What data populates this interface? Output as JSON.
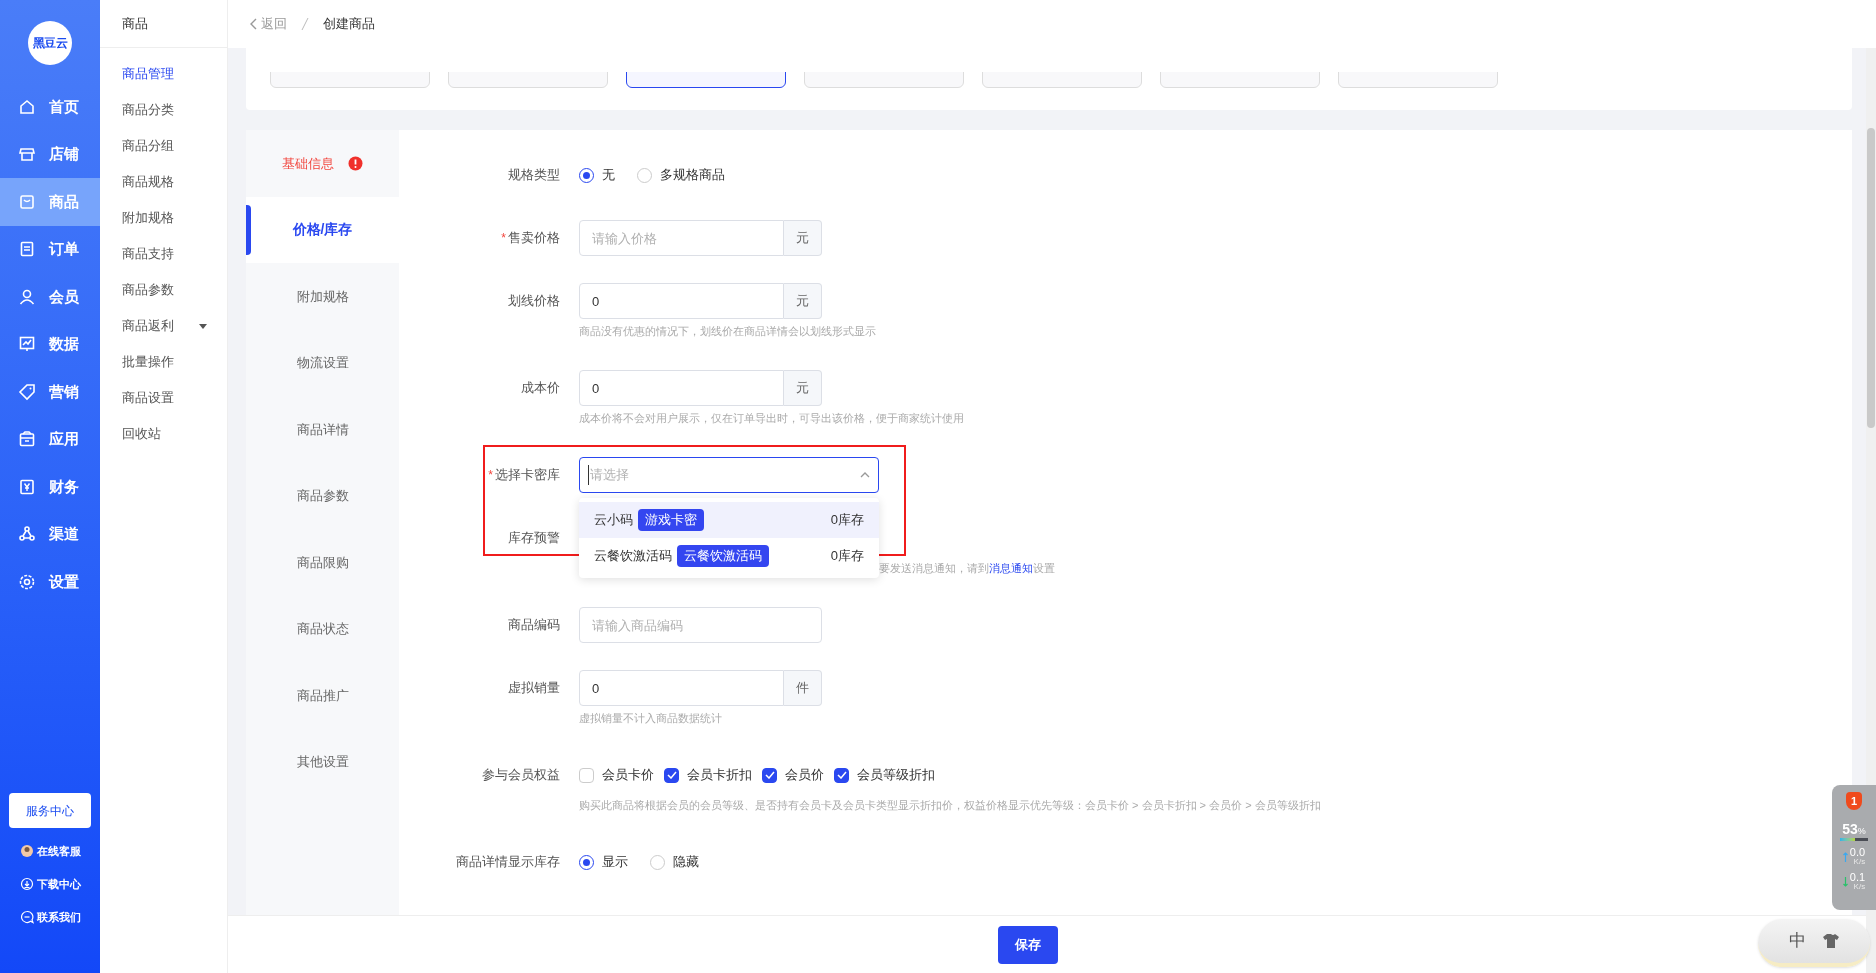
{
  "sidebar": {
    "logo": "黑豆云",
    "items": [
      {
        "label": "首页",
        "selected": false
      },
      {
        "label": "店铺",
        "selected": false
      },
      {
        "label": "商品",
        "selected": true
      },
      {
        "label": "订单",
        "selected": false
      },
      {
        "label": "会员",
        "selected": false
      },
      {
        "label": "数据",
        "selected": false
      },
      {
        "label": "营销",
        "selected": false
      },
      {
        "label": "应用",
        "selected": false
      },
      {
        "label": "财务",
        "selected": false
      },
      {
        "label": "渠道",
        "selected": false
      },
      {
        "label": "设置",
        "selected": false
      }
    ],
    "service_button": "服务中心",
    "links": [
      "在线客服",
      "下载中心",
      "联系我们"
    ]
  },
  "submenu": {
    "title": "商品",
    "items": [
      {
        "label": "商品管理",
        "selected": true,
        "kind": "link"
      },
      {
        "label": "商品分类",
        "selected": false,
        "kind": "link"
      },
      {
        "label": "商品分组",
        "selected": false,
        "kind": "link"
      },
      {
        "label": "商品规格",
        "selected": false,
        "kind": "link"
      },
      {
        "label": "附加规格",
        "selected": false,
        "kind": "link"
      },
      {
        "label": "商品支持",
        "selected": false,
        "kind": "link"
      },
      {
        "label": "商品参数",
        "selected": false,
        "kind": "link"
      },
      {
        "label": "商品返利",
        "selected": false,
        "kind": "group"
      },
      {
        "label": "批量操作",
        "selected": false,
        "kind": "link"
      },
      {
        "label": "商品设置",
        "selected": false,
        "kind": "link"
      },
      {
        "label": "回收站",
        "selected": false,
        "kind": "link"
      }
    ]
  },
  "breadcrumb": {
    "back": "返回",
    "current": "创建商品"
  },
  "type_tabs": [
    {
      "selected": false
    },
    {
      "selected": false
    },
    {
      "selected": true
    },
    {
      "selected": false
    },
    {
      "selected": false
    },
    {
      "selected": false
    },
    {
      "selected": false
    }
  ],
  "section_nav": [
    {
      "label": "基础信息",
      "selected": false,
      "error": true
    },
    {
      "label": "价格/库存",
      "selected": true,
      "error": false
    },
    {
      "label": "附加规格",
      "selected": false,
      "error": false
    },
    {
      "label": "物流设置",
      "selected": false,
      "error": false
    },
    {
      "label": "商品详情",
      "selected": false,
      "error": false
    },
    {
      "label": "商品参数",
      "selected": false,
      "error": false
    },
    {
      "label": "商品限购",
      "selected": false,
      "error": false
    },
    {
      "label": "商品状态",
      "selected": false,
      "error": false
    },
    {
      "label": "商品推广",
      "selected": false,
      "error": false
    },
    {
      "label": "其他设置",
      "selected": false,
      "error": false
    }
  ],
  "form": [
    {
      "kind": "radio",
      "label": "规格类型",
      "options": [
        {
          "label": "无",
          "selected": true
        },
        {
          "label": "多规格商品",
          "selected": false
        }
      ]
    },
    {
      "kind": "input",
      "label": "售卖价格",
      "required_mark": "*",
      "placeholder": "请输入价格",
      "unit": "元"
    },
    {
      "kind": "input",
      "label": "划线价格",
      "value": "0",
      "unit": "元",
      "hint": "商品没有优惠的情况下，划线价在商品详情会以划线形式显示"
    },
    {
      "kind": "input",
      "label": "成本价",
      "value": "0",
      "unit": "元",
      "hint": "成本价将不会对用户展示，仅在订单导出时，可导出该价格，便于商家统计使用"
    },
    {
      "kind": "select",
      "label": "选择卡密库",
      "required_mark": "*",
      "placeholder": "请选择",
      "expanded": true,
      "options": [
        {
          "name": "云小码",
          "tag": "游戏卡密",
          "stock": "0库存",
          "selected": true
        },
        {
          "name": "云餐饮激活码",
          "tag": "云餐饮激活码",
          "stock": "0库存",
          "selected": false
        }
      ]
    },
    {
      "kind": "covered",
      "label": "库存预警",
      "hint": "要发送消息通知，请到",
      "hint_link": "消息通知",
      "hint_end": "设置"
    },
    {
      "kind": "input",
      "label": "商品编码",
      "placeholder": "请输入商品编码"
    },
    {
      "kind": "input",
      "label": "虚拟销量",
      "value": "0",
      "unit": "件",
      "hint": "虚拟销量不计入商品数据统计"
    },
    {
      "kind": "checkbox",
      "label": "参与会员权益",
      "options": [
        {
          "label": "会员卡价",
          "checked": false
        },
        {
          "label": "会员卡折扣",
          "checked": true
        },
        {
          "label": "会员价",
          "checked": true
        },
        {
          "label": "会员等级折扣",
          "checked": true
        }
      ],
      "hint": "购买此商品将根据会员的会员等级、是否持有会员卡及会员卡类型显示折扣价，权益价格显示优先等级：会员卡价 > 会员卡折扣 > 会员价 > 会员等级折扣"
    },
    {
      "kind": "radio",
      "label": "商品详情显示库存",
      "options": [
        {
          "label": "显示",
          "selected": true
        },
        {
          "label": "隐藏",
          "selected": false
        }
      ]
    }
  ],
  "footer": {
    "save": "保存"
  },
  "system_monitor": {
    "alerts": "1",
    "cpu": "53",
    "cpu_unit": "%",
    "up": "0.0",
    "up_unit": "K/s",
    "down": "0.1",
    "down_unit": "K/s"
  },
  "ime": {
    "mode": "中"
  }
}
